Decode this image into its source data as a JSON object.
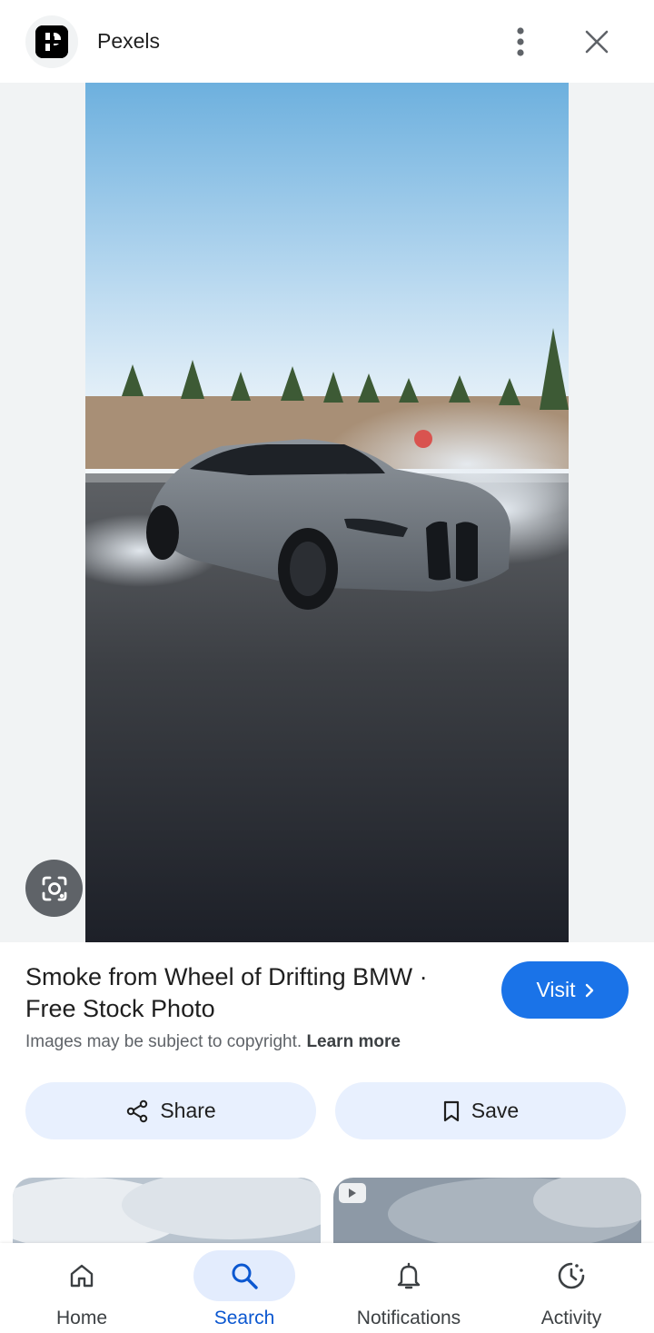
{
  "header": {
    "site_name": "Pexels",
    "logo_icon": "pexels-logo-icon",
    "more_icon": "more-vert-icon",
    "close_icon": "close-icon"
  },
  "image": {
    "lens_icon": "google-lens-icon"
  },
  "info": {
    "title": "Smoke from Wheel of Drifting BMW · Free Stock Photo",
    "visit_label": "Visit",
    "copyright_text": "Images may be subject to copyright.",
    "learn_more": "Learn more"
  },
  "actions": {
    "share_label": "Share",
    "save_label": "Save"
  },
  "bottom_nav": {
    "items": [
      {
        "label": "Home",
        "icon": "home-icon"
      },
      {
        "label": "Search",
        "icon": "search-icon",
        "active": true
      },
      {
        "label": "Notifications",
        "icon": "bell-icon"
      },
      {
        "label": "Activity",
        "icon": "activity-icon"
      }
    ]
  },
  "colors": {
    "accent": "#1a73e8",
    "pill_bg": "#e8f0fe",
    "active_nav": "#0b57d0"
  }
}
